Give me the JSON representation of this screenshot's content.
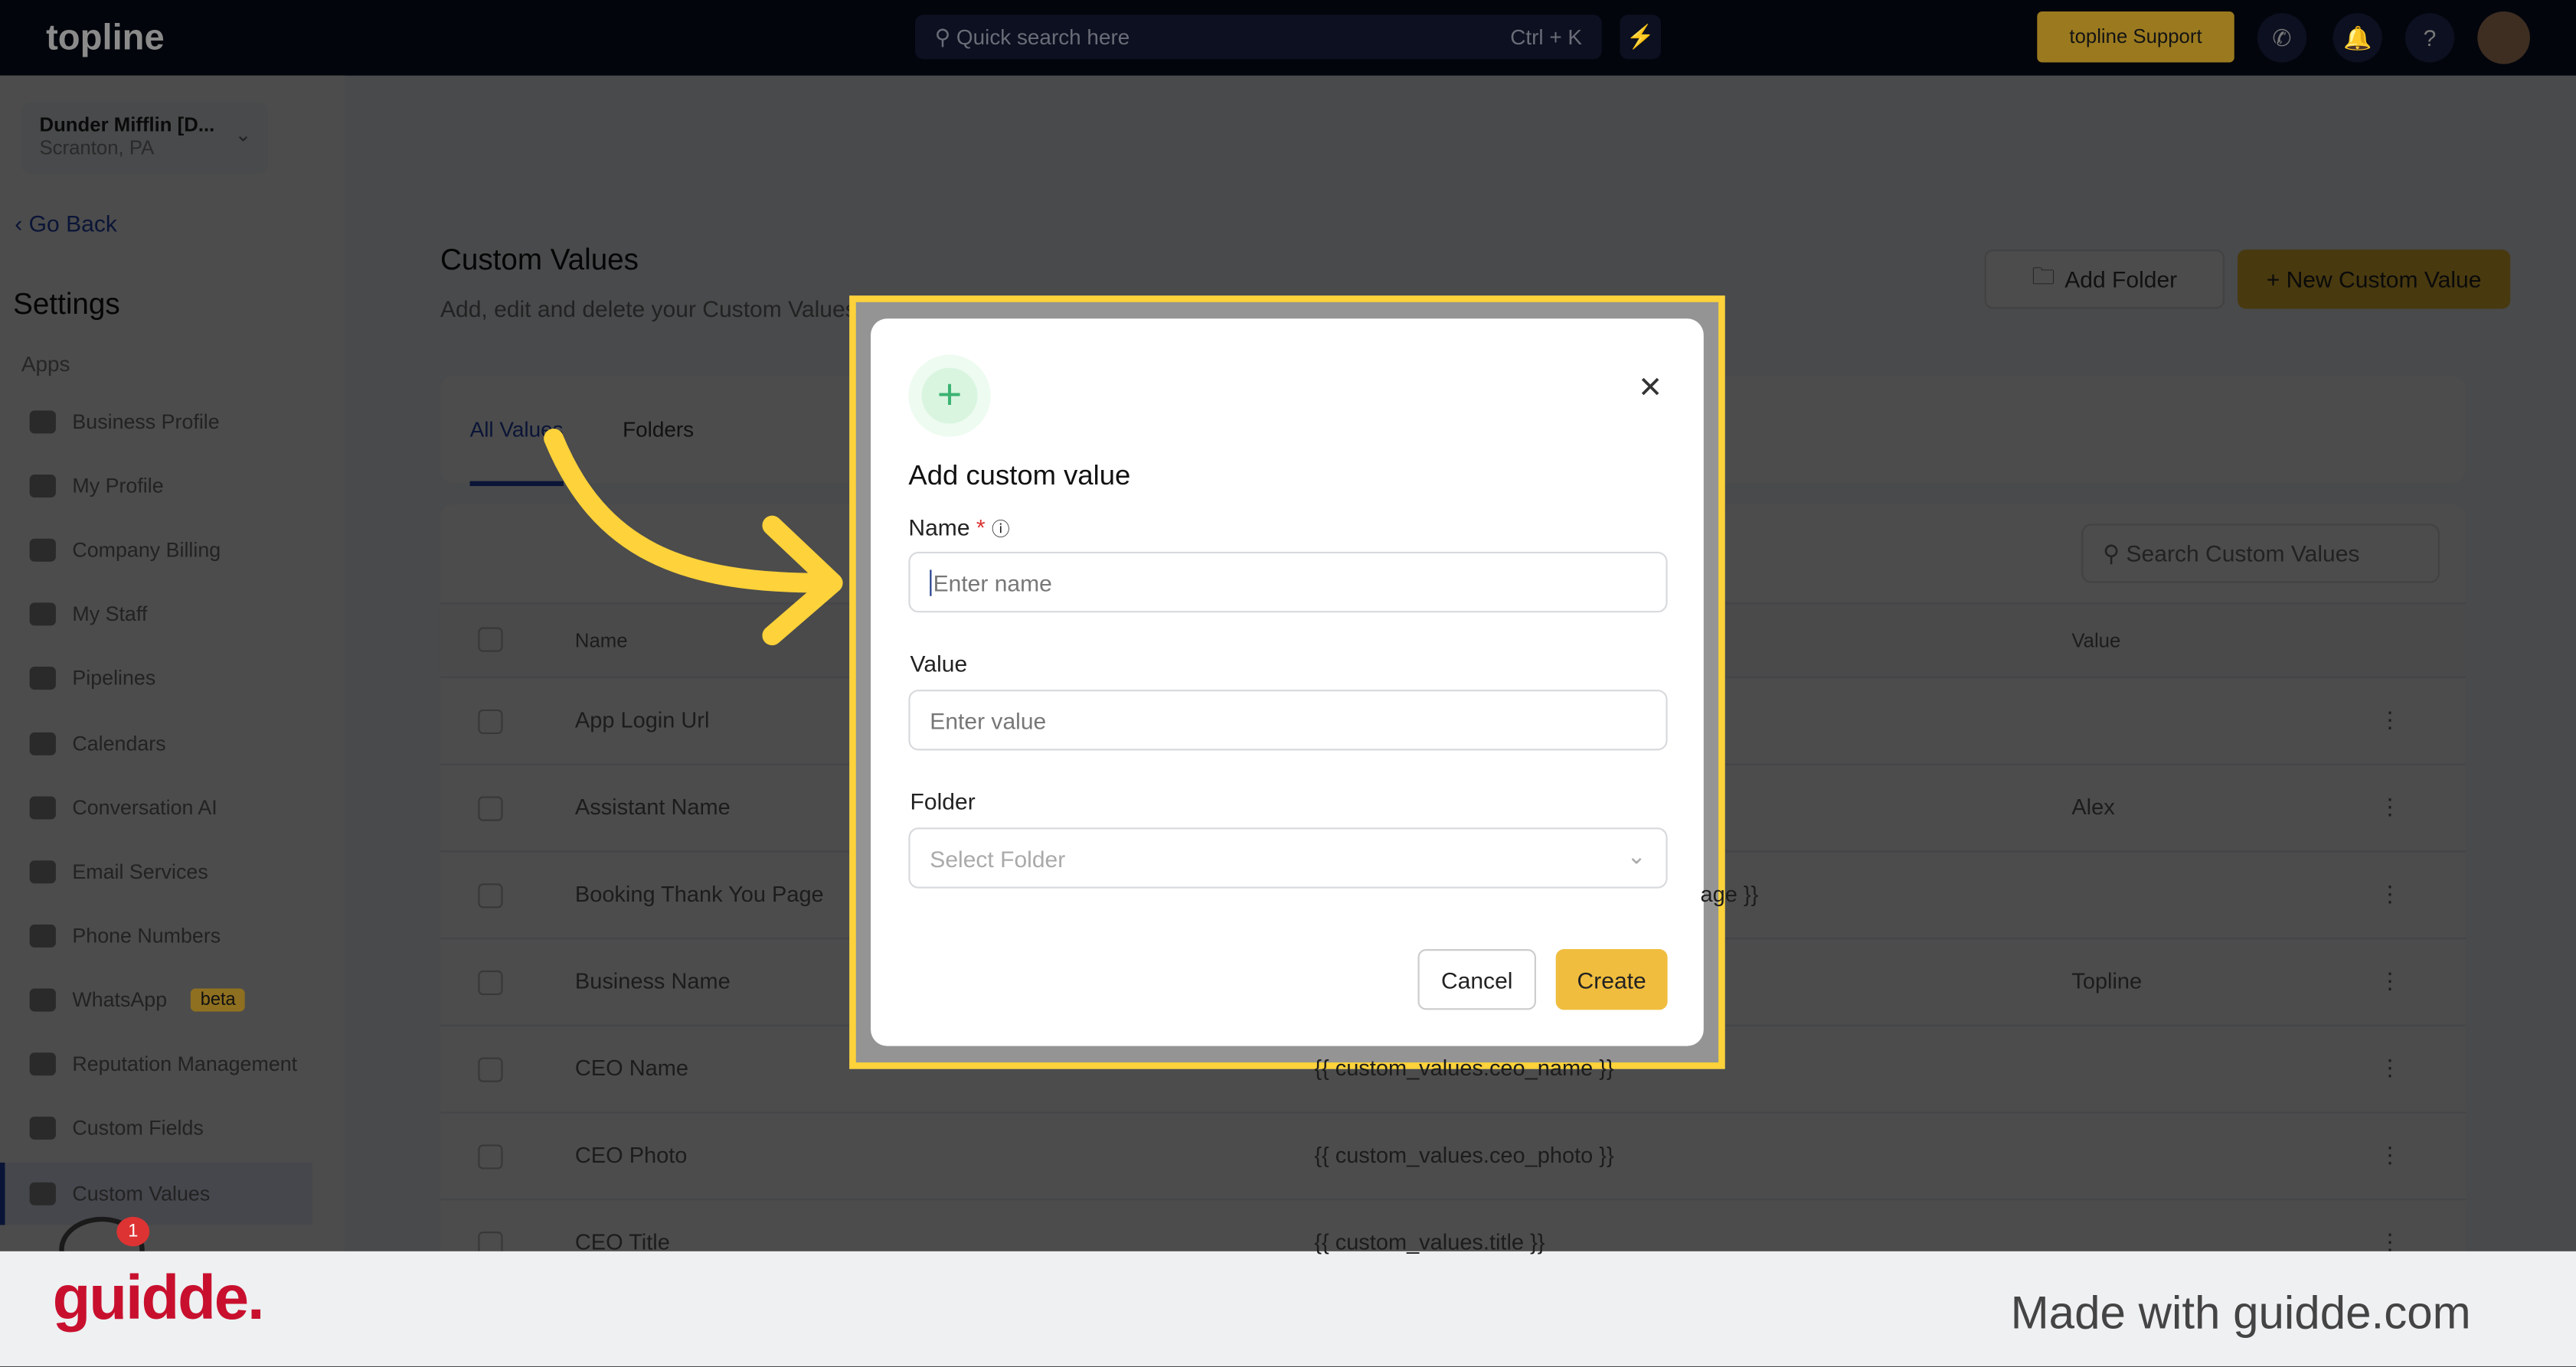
{
  "topbar": {
    "logo": "topline",
    "search_placeholder": "Quick search here",
    "shortcut": "Ctrl + K",
    "support_label": "topline Support"
  },
  "sidebar": {
    "account_name": "Dunder Mifflin [D...",
    "account_location": "Scranton, PA",
    "go_back": "Go Back",
    "settings_title": "Settings",
    "section": "Apps",
    "items": [
      {
        "label": "Business Profile"
      },
      {
        "label": "My Profile"
      },
      {
        "label": "Company Billing"
      },
      {
        "label": "My Staff"
      },
      {
        "label": "Pipelines"
      },
      {
        "label": "Calendars"
      },
      {
        "label": "Conversation AI"
      },
      {
        "label": "Email Services"
      },
      {
        "label": "Phone Numbers"
      },
      {
        "label": "WhatsApp"
      },
      {
        "label": "Reputation Management"
      },
      {
        "label": "Custom Fields"
      },
      {
        "label": "Custom Values"
      }
    ],
    "whatsapp_badge": "beta",
    "notification_count": "1"
  },
  "main": {
    "title": "Custom Values",
    "subtitle": "Add, edit and delete your Custom Values.",
    "add_folder": "Add Folder",
    "new_value": "+ New Custom Value",
    "tabs": [
      {
        "label": "All Values"
      },
      {
        "label": "Folders"
      }
    ],
    "search_placeholder": "Search Custom Values",
    "columns": {
      "name": "Name",
      "value": "Value"
    },
    "rows": [
      {
        "name": "App Login Url",
        "key": "",
        "value": ""
      },
      {
        "name": "Assistant Name",
        "key": "",
        "value": "Alex"
      },
      {
        "name": "Booking Thank You Page",
        "key": "age }}",
        "value": ""
      },
      {
        "name": "Business Name",
        "key": "",
        "value": "Topline"
      },
      {
        "name": "CEO Name",
        "key": "{{ custom_values.ceo_name }}",
        "value": ""
      },
      {
        "name": "CEO Photo",
        "key": "{{ custom_values.ceo_photo }}",
        "value": ""
      },
      {
        "name": "CEO Title",
        "key": "{{ custom_values.title }}",
        "value": ""
      }
    ]
  },
  "modal": {
    "title": "Add custom value",
    "name_label": "Name",
    "required": "*",
    "name_placeholder": "Enter name",
    "value_label": "Value",
    "value_placeholder": "Enter value",
    "folder_label": "Folder",
    "folder_placeholder": "Select Folder",
    "cancel": "Cancel",
    "create": "Create"
  },
  "footer": {
    "brand": "guidde.",
    "tagline": "Made with guidde.com"
  },
  "colors": {
    "accent": "#f0bd3e",
    "highlight": "#fdd23a",
    "brand_red": "#c8102e"
  }
}
